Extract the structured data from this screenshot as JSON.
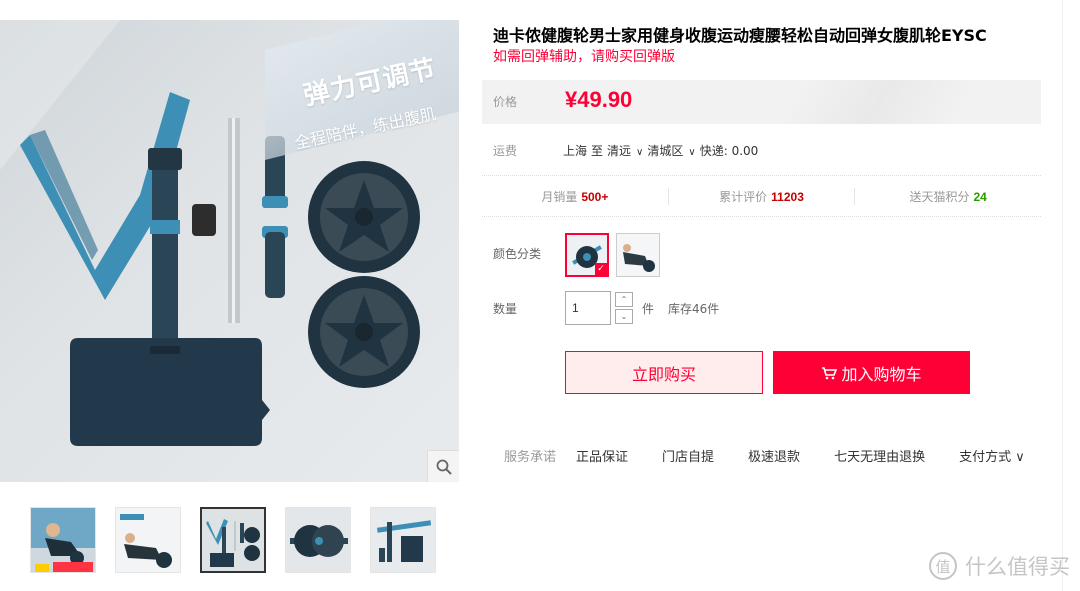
{
  "product": {
    "title": "迪卡侬健腹轮男士家用健身收腹运动瘦腰轻松自动回弹女腹肌轮EYSC",
    "subtitle": "如需回弹辅助，请购买回弹版"
  },
  "gallery": {
    "promo_title": "弹力可调节",
    "promo_subtitle": "全程陪伴，练出腹肌",
    "zoom_icon": "search-icon",
    "thumbnail_count": 5,
    "active_thumbnail": 3
  },
  "price": {
    "label": "价格",
    "value": "¥49.90"
  },
  "shipping": {
    "label": "运费",
    "from": "上海",
    "to_word": "至",
    "city": "清远",
    "district": "清城区",
    "express": "快递: 0.00"
  },
  "stats": {
    "monthly_sales_label": "月销量",
    "monthly_sales_value": "500+",
    "reviews_label": "累计评价",
    "reviews_value": "11203",
    "points_label": "送天猫积分",
    "points_value": "24"
  },
  "sku": {
    "label": "颜色分类",
    "selected_index": 1
  },
  "quantity": {
    "label": "数量",
    "value": "1",
    "unit": "件",
    "stock": "库存46件",
    "up_glyph": "⌃",
    "down_glyph": "⌄"
  },
  "actions": {
    "buy_now": "立即购买",
    "add_cart": "加入购物车",
    "cart_glyph": "🛒"
  },
  "service": {
    "label": "服务承诺",
    "items": [
      "正品保证",
      "门店自提",
      "极速退款",
      "七天无理由退换"
    ],
    "payment": "支付方式"
  },
  "watermark": {
    "glyph": "值",
    "text": "什么值得买"
  },
  "colors": {
    "accent": "#ff0036",
    "price_bg": "#f2f2f2"
  }
}
